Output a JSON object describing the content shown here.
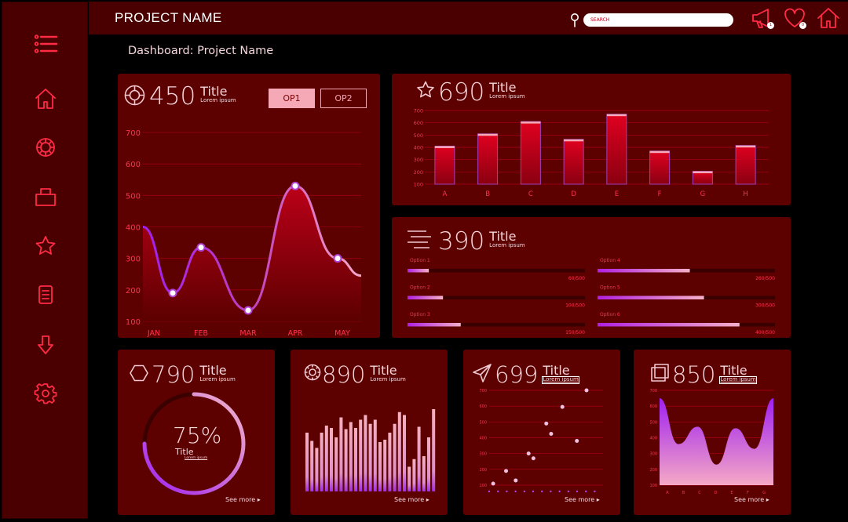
{
  "header": {
    "project_name": "PROJECT NAME",
    "search_placeholder": "SEARCH",
    "notif_badge": "1",
    "likes_badge": "0"
  },
  "dashboard_title": "Dashboard: Project Name",
  "colors": {
    "bg": "#000000",
    "panel": "#5c0000",
    "sidebar": "#4a0000",
    "accent": "#ff2a44",
    "pink": "#f5a9b6",
    "purple": "#a020f0"
  },
  "sidebar": {
    "items": [
      {
        "icon": "menu-icon"
      },
      {
        "icon": "home-icon"
      },
      {
        "icon": "dashboard-icon"
      },
      {
        "icon": "box-icon"
      },
      {
        "icon": "star-icon"
      },
      {
        "icon": "document-icon"
      },
      {
        "icon": "download-icon"
      },
      {
        "icon": "settings-icon"
      }
    ]
  },
  "cards": {
    "c450": {
      "value": "450",
      "title": "Title",
      "subtitle": "Lorem ipsum",
      "op1": "OP1",
      "op2": "OP2"
    },
    "c690": {
      "value": "690",
      "title": "Title",
      "subtitle": "Lorem ipsum"
    },
    "c390": {
      "value": "390",
      "title": "Title",
      "subtitle": "Lorem ipsum"
    },
    "c790": {
      "value": "790",
      "title": "Title",
      "subtitle": "Lorem ipsum",
      "percent": "75%",
      "inner_title": "Title",
      "inner_sub": "Lorem ipsum",
      "see_more": "See more"
    },
    "c890": {
      "value": "890",
      "title": "Title",
      "subtitle": "Lorem ipsum",
      "see_more": "See more"
    },
    "c699": {
      "value": "699",
      "title": "Title",
      "subtitle": "Lorem ipsum",
      "see_more": "See more"
    },
    "c850": {
      "value": "850",
      "title": "Title",
      "subtitle": "Lorem ipsum",
      "see_more": "See more"
    }
  },
  "progress": [
    {
      "label": "Option 1",
      "value": 60,
      "max": 500,
      "text": "60/500"
    },
    {
      "label": "Option 2",
      "value": 100,
      "max": 500,
      "text": "100/500"
    },
    {
      "label": "Option 3",
      "value": 150,
      "max": 500,
      "text": "150/500"
    },
    {
      "label": "Option 4",
      "value": 260,
      "max": 500,
      "text": "260/500"
    },
    {
      "label": "Option 5",
      "value": 300,
      "max": 500,
      "text": "300/500"
    },
    {
      "label": "Option 6",
      "value": 400,
      "max": 500,
      "text": "400/500"
    }
  ],
  "gauge_fraction": 0.75,
  "chart_data": [
    {
      "type": "area",
      "categories": [
        "JAN",
        "FEB",
        "MAR",
        "APR",
        "MAY"
      ],
      "x": [
        0.4,
        1,
        2,
        3,
        3.9
      ],
      "values": [
        190,
        335,
        135,
        530,
        300
      ],
      "y_ticks": [
        100,
        200,
        300,
        400,
        500,
        600,
        700
      ],
      "ylim": [
        100,
        700
      ],
      "grid": true
    },
    {
      "type": "bar",
      "categories": [
        "A",
        "B",
        "C",
        "D",
        "E",
        "F",
        "G",
        "H"
      ],
      "values": [
        410,
        510,
        610,
        465,
        670,
        370,
        205,
        415
      ],
      "y_ticks": [
        100,
        200,
        300,
        400,
        500,
        600,
        700
      ],
      "ylim": [
        100,
        700
      ],
      "grid": true
    },
    {
      "type": "bar",
      "values": [
        1.0,
        0.86,
        0.74,
        1.0,
        1.12,
        1.08,
        0.92,
        1.26,
        1.06,
        1.18,
        1.08,
        1.22,
        1.3,
        1.15,
        1.22,
        0.84,
        0.88,
        1.0,
        1.15,
        1.35,
        1.3,
        0.42,
        0.55,
        1.1,
        0.6,
        0.92,
        1.4
      ]
    },
    {
      "type": "scatter",
      "points": [
        [
          0.2,
          110
        ],
        [
          1,
          190
        ],
        [
          1.6,
          130
        ],
        [
          2.4,
          300
        ],
        [
          2.7,
          270
        ],
        [
          3.5,
          490
        ],
        [
          3.8,
          425
        ],
        [
          4.5,
          595
        ],
        [
          5.4,
          380
        ],
        [
          6,
          700
        ]
      ],
      "y_ticks": [
        100,
        200,
        300,
        400,
        500,
        600,
        700
      ],
      "ylim": [
        100,
        700
      ],
      "grid": true
    },
    {
      "type": "area",
      "categories": [
        "A",
        "B",
        "C",
        "D",
        "E",
        "F",
        "G"
      ],
      "values": [
        650,
        360,
        470,
        230,
        460,
        330,
        650
      ],
      "y_ticks": [
        100,
        200,
        300,
        400,
        500,
        600,
        700
      ],
      "ylim": [
        100,
        700
      ],
      "grid": true
    }
  ]
}
